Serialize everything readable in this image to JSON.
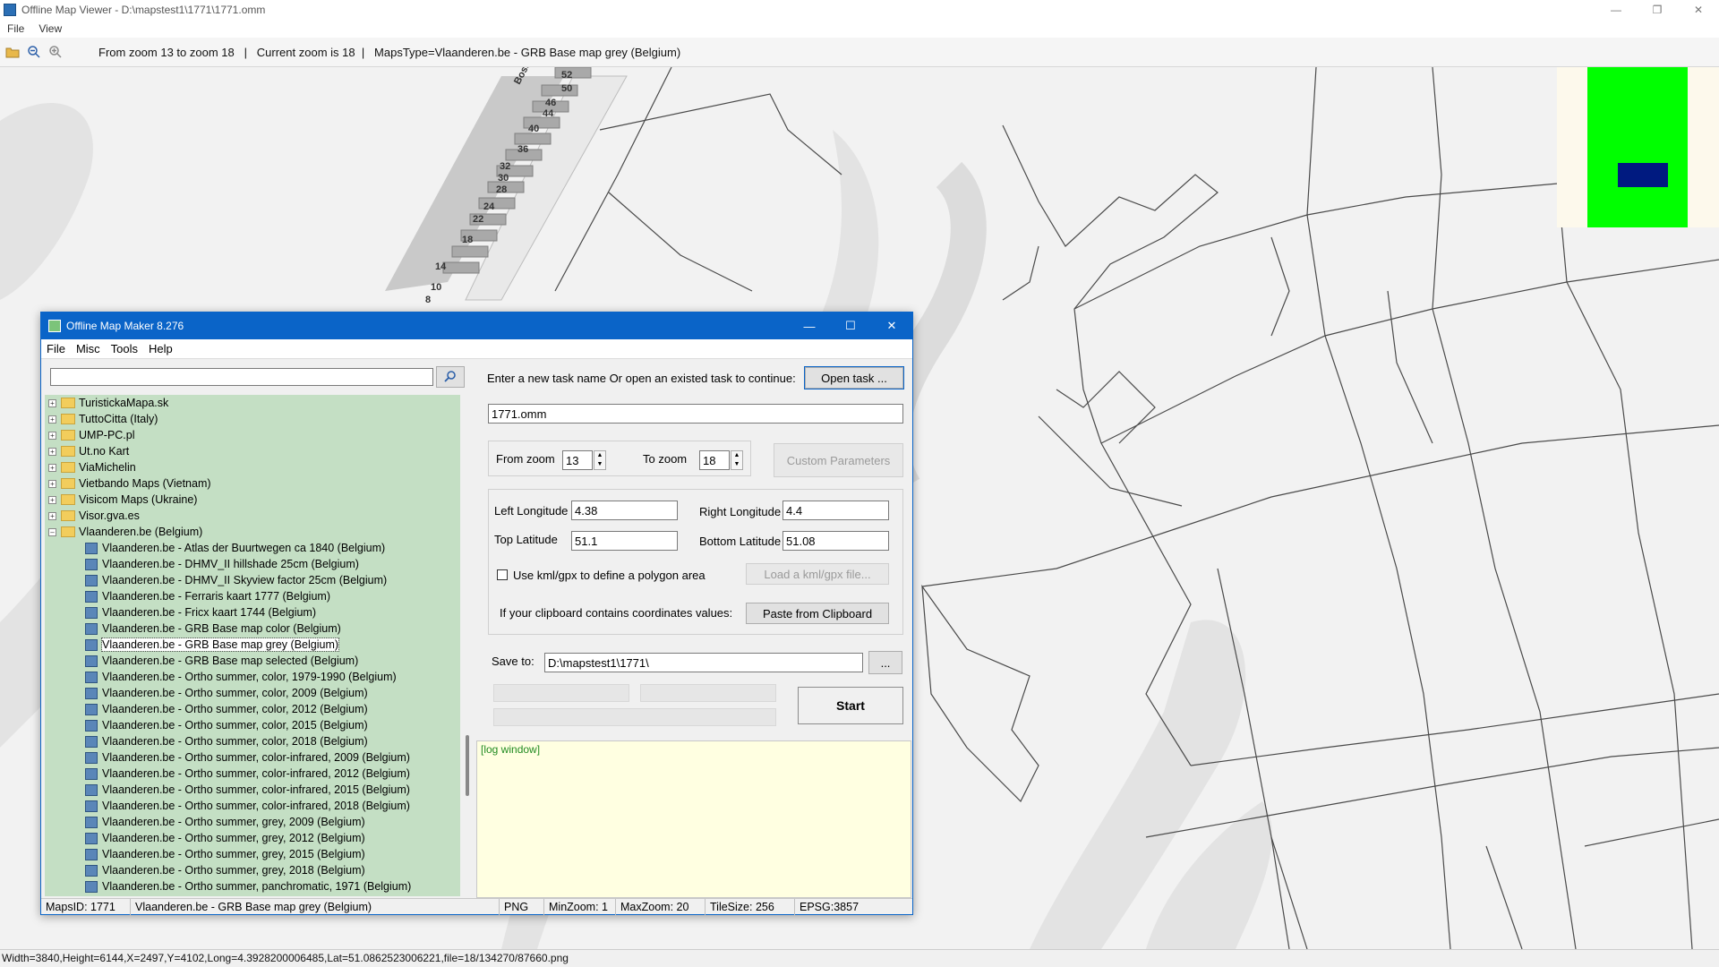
{
  "window": {
    "title": "Offline Map Viewer - D:\\mapstest1\\1771\\1771.omm"
  },
  "menu": {
    "file": "File",
    "view": "View"
  },
  "toolbar": {
    "info": "From zoom 13 to zoom 18   |   Current zoom is 18  |   MapsType=Vlaanderen.be - GRB Base map grey (Belgium)"
  },
  "map": {
    "house_numbers": [
      "52",
      "50",
      "46",
      "44",
      "40",
      "36",
      "32",
      "30",
      "28",
      "24",
      "22",
      "18",
      "14",
      "10",
      "8"
    ],
    "street_label": "Boss",
    "minimap": {
      "bg": "#fdf9ec",
      "green": "#00ff00",
      "blue": "#001a80"
    }
  },
  "dialog": {
    "title": "Offline Map Maker 8.276",
    "menu": [
      "File",
      "Misc",
      "Tools",
      "Help"
    ],
    "search": {
      "value": ""
    },
    "tree": {
      "folders": [
        "TuristickaMapa.sk",
        "TuttoCitta (Italy)",
        "UMP-PC.pl",
        "Ut.no Kart",
        "ViaMichelin",
        "Vietbando Maps (Vietnam)",
        "Visicom Maps (Ukraine)",
        "Visor.gva.es"
      ],
      "open_folder": "Vlaanderen.be (Belgium)",
      "maps": [
        "Vlaanderen.be - Atlas der Buurtwegen ca 1840 (Belgium)",
        "Vlaanderen.be - DHMV_II hillshade 25cm (Belgium)",
        "Vlaanderen.be - DHMV_II Skyview factor 25cm (Belgium)",
        "Vlaanderen.be - Ferraris kaart 1777 (Belgium)",
        "Vlaanderen.be - Fricx kaart 1744 (Belgium)",
        "Vlaanderen.be - GRB Base map color (Belgium)",
        "Vlaanderen.be - GRB Base map grey (Belgium)",
        "Vlaanderen.be - GRB Base map selected (Belgium)",
        "Vlaanderen.be - Ortho summer, color, 1979-1990 (Belgium)",
        "Vlaanderen.be - Ortho summer, color, 2009 (Belgium)",
        "Vlaanderen.be - Ortho summer, color, 2012 (Belgium)",
        "Vlaanderen.be - Ortho summer, color, 2015 (Belgium)",
        "Vlaanderen.be - Ortho summer, color, 2018 (Belgium)",
        "Vlaanderen.be - Ortho summer, color-infrared, 2009 (Belgium)",
        "Vlaanderen.be - Ortho summer, color-infrared, 2012 (Belgium)",
        "Vlaanderen.be - Ortho summer, color-infrared, 2015 (Belgium)",
        "Vlaanderen.be - Ortho summer, color-infrared, 2018 (Belgium)",
        "Vlaanderen.be - Ortho summer, grey, 2009 (Belgium)",
        "Vlaanderen.be - Ortho summer, grey, 2012 (Belgium)",
        "Vlaanderen.be - Ortho summer, grey, 2015 (Belgium)",
        "Vlaanderen.be - Ortho summer, grey, 2018 (Belgium)",
        "Vlaanderen.be - Ortho summer, panchromatic, 1971 (Belgium)"
      ],
      "selected_index": 6
    },
    "task": {
      "prompt": "Enter a new task name Or open an existed task to continue:",
      "open_button": "Open task ...",
      "name_value": "1771.omm"
    },
    "zoom": {
      "from_label": "From zoom",
      "from_value": "13",
      "to_label": "To zoom",
      "to_value": "18",
      "custom_button": "Custom Parameters"
    },
    "coords": {
      "left_label": "Left Longitude",
      "left_value": "4.38",
      "right_label": "Right Longitude",
      "right_value": "4.4",
      "top_label": "Top Latitude",
      "top_value": "51.1",
      "bottom_label": "Bottom Latitude",
      "bottom_value": "51.08",
      "kml_label": "Use kml/gpx to define a polygon area",
      "kml_checked": false,
      "load_kml_button": "Load a kml/gpx file...",
      "clipboard_label": "If your clipboard contains coordinates values:",
      "clipboard_button": "Paste from Clipboard"
    },
    "save": {
      "label": "Save to:",
      "value": "D:\\mapstest1\\1771\\",
      "browse_button": "...",
      "start_button": "Start"
    },
    "log": {
      "text": "[log window]"
    },
    "status": {
      "maps_id": "MapsID: 1771",
      "map_name": "Vlaanderen.be - GRB Base map grey (Belgium)",
      "format": "PNG",
      "min_zoom": "MinZoom: 1",
      "max_zoom": "MaxZoom: 20",
      "tile_size": "TileSize: 256",
      "epsg": "EPSG:3857"
    }
  },
  "statusbar": {
    "text": "Width=3840,Height=6144,X=2497,Y=4102,Long=4.3928200006485,Lat=51.0862523006221,file=18/134270/87660.png"
  }
}
